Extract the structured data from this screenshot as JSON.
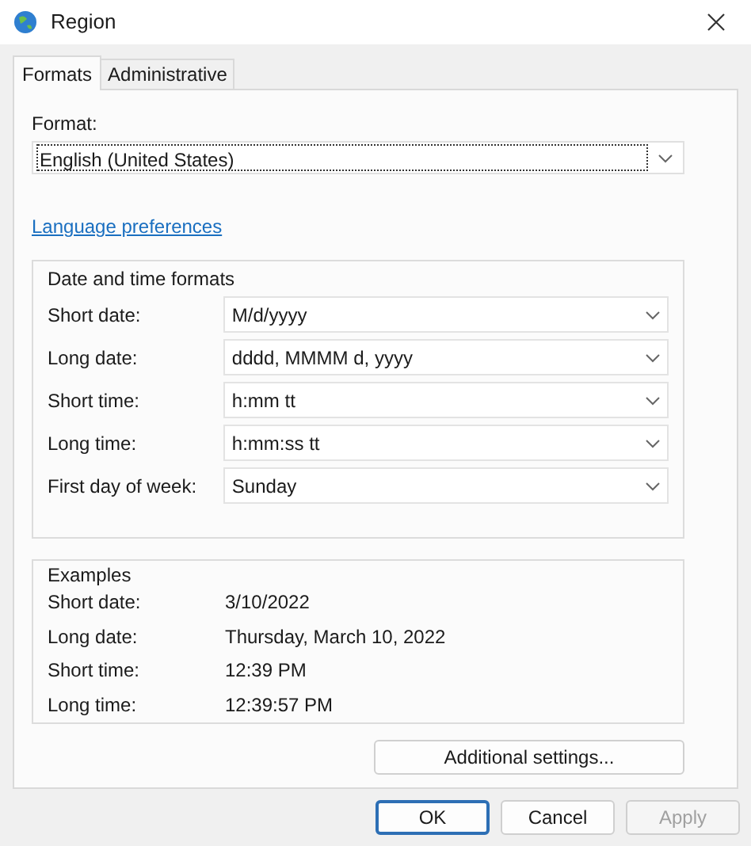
{
  "window": {
    "title": "Region"
  },
  "tabs": [
    {
      "label": "Formats",
      "selected": true
    },
    {
      "label": "Administrative",
      "selected": false
    }
  ],
  "format": {
    "label": "Format:",
    "value": "English (United States)",
    "focused": true
  },
  "link": "Language preferences",
  "date_time_formats": {
    "title": "Date and time formats",
    "rows": [
      {
        "label": "Short date:",
        "value": "M/d/yyyy"
      },
      {
        "label": "Long date:",
        "value": "dddd, MMMM d, yyyy"
      },
      {
        "label": "Short time:",
        "value": "h:mm tt"
      },
      {
        "label": "Long time:",
        "value": "h:mm:ss tt"
      },
      {
        "label": "First day of week:",
        "value": "Sunday"
      }
    ]
  },
  "examples": {
    "title": "Examples",
    "rows": [
      {
        "label": "Short date:",
        "value": "3/10/2022"
      },
      {
        "label": "Long date:",
        "value": "Thursday, March 10, 2022"
      },
      {
        "label": "Short time:",
        "value": "12:39 PM"
      },
      {
        "label": "Long time:",
        "value": "12:39:57 PM"
      }
    ]
  },
  "additional_button": "Additional settings...",
  "buttons": [
    {
      "label": "OK",
      "focused": true,
      "disabled": false
    },
    {
      "label": "Cancel",
      "focused": false,
      "disabled": false
    },
    {
      "label": "Apply",
      "focused": false,
      "disabled": true
    }
  ]
}
